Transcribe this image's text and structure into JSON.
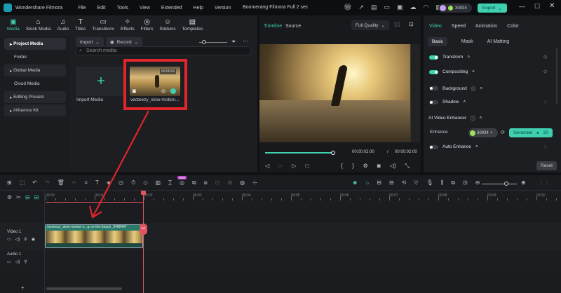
{
  "app": {
    "name": "Wondershare Filmora",
    "project_title": "Boomerang Filmora Full 2 sec",
    "menu": [
      "File",
      "Edit",
      "Tools",
      "View",
      "Extended",
      "Help",
      "Version"
    ],
    "credits": "30934",
    "export_label": "Export"
  },
  "toolbar": {
    "tabs": [
      "Media",
      "Stock Media",
      "Audio",
      "Titles",
      "Transitions",
      "Effects",
      "Filters",
      "Stickers",
      "Templates"
    ],
    "icons": [
      "media-icon",
      "stock-icon",
      "audio-icon",
      "titles-icon",
      "transitions-icon",
      "effects-icon",
      "filters-icon",
      "stickers-icon",
      "templates-icon"
    ],
    "glyphs": [
      "▣",
      "⌂",
      "♫",
      "T",
      "▭",
      "✧",
      "◎",
      "☺",
      "▤"
    ]
  },
  "sidebar": {
    "items": [
      {
        "label": "Project Media"
      },
      {
        "label": "Folder"
      },
      {
        "label": "Global Media"
      },
      {
        "label": "Cloud Media"
      },
      {
        "label": "Editing Presets"
      },
      {
        "label": "Influence Kit"
      }
    ]
  },
  "media": {
    "import_label": "Import",
    "record_label": "Record",
    "search_placeholder": "Search media",
    "import_media_label": "Import Media",
    "clip_name": "vecteezy_slow-motion...",
    "clip_duration": "00:00:02"
  },
  "preview": {
    "tabs": [
      "Timeline",
      "Source"
    ],
    "quality": "Full Quality",
    "current_time": "00:00:02:00",
    "separator": "/",
    "total_time": "00:00:02:00",
    "progress": 1.0
  },
  "properties": {
    "tabs": [
      "Video",
      "Speed",
      "Animation",
      "Color"
    ],
    "subtabs": [
      "Basic",
      "Mask",
      "AI Matting"
    ],
    "items": [
      {
        "label": "Transform",
        "on": true
      },
      {
        "label": "Compositing",
        "on": true
      },
      {
        "label": "Background",
        "on": false
      },
      {
        "label": "Shadow",
        "on": false
      }
    ],
    "enhancer_title": "AI Video Enhancer",
    "enhance_label": "Enhance",
    "credits": "30934",
    "generate_label": "Generate",
    "generate_cost": "20",
    "auto_enhance_label": "Auto Enhance",
    "reset_label": "Reset"
  },
  "timeline": {
    "ruler": [
      "00:00",
      "00:01",
      "00:02",
      "00:03",
      "00:04",
      "00:05",
      "00:06",
      "00:07",
      "00:08",
      "00:09",
      "00:10"
    ],
    "tracks": [
      {
        "label": "Video 1"
      },
      {
        "label": "Audio 1"
      }
    ],
    "clip_label": "vecteezy_slow-motion-s...g-on-the-beach_3468447",
    "new_badge": "NEW"
  },
  "colors": {
    "accent": "#3fd0b0",
    "annotation": "#e0262b",
    "playhead": "#e0555f"
  }
}
